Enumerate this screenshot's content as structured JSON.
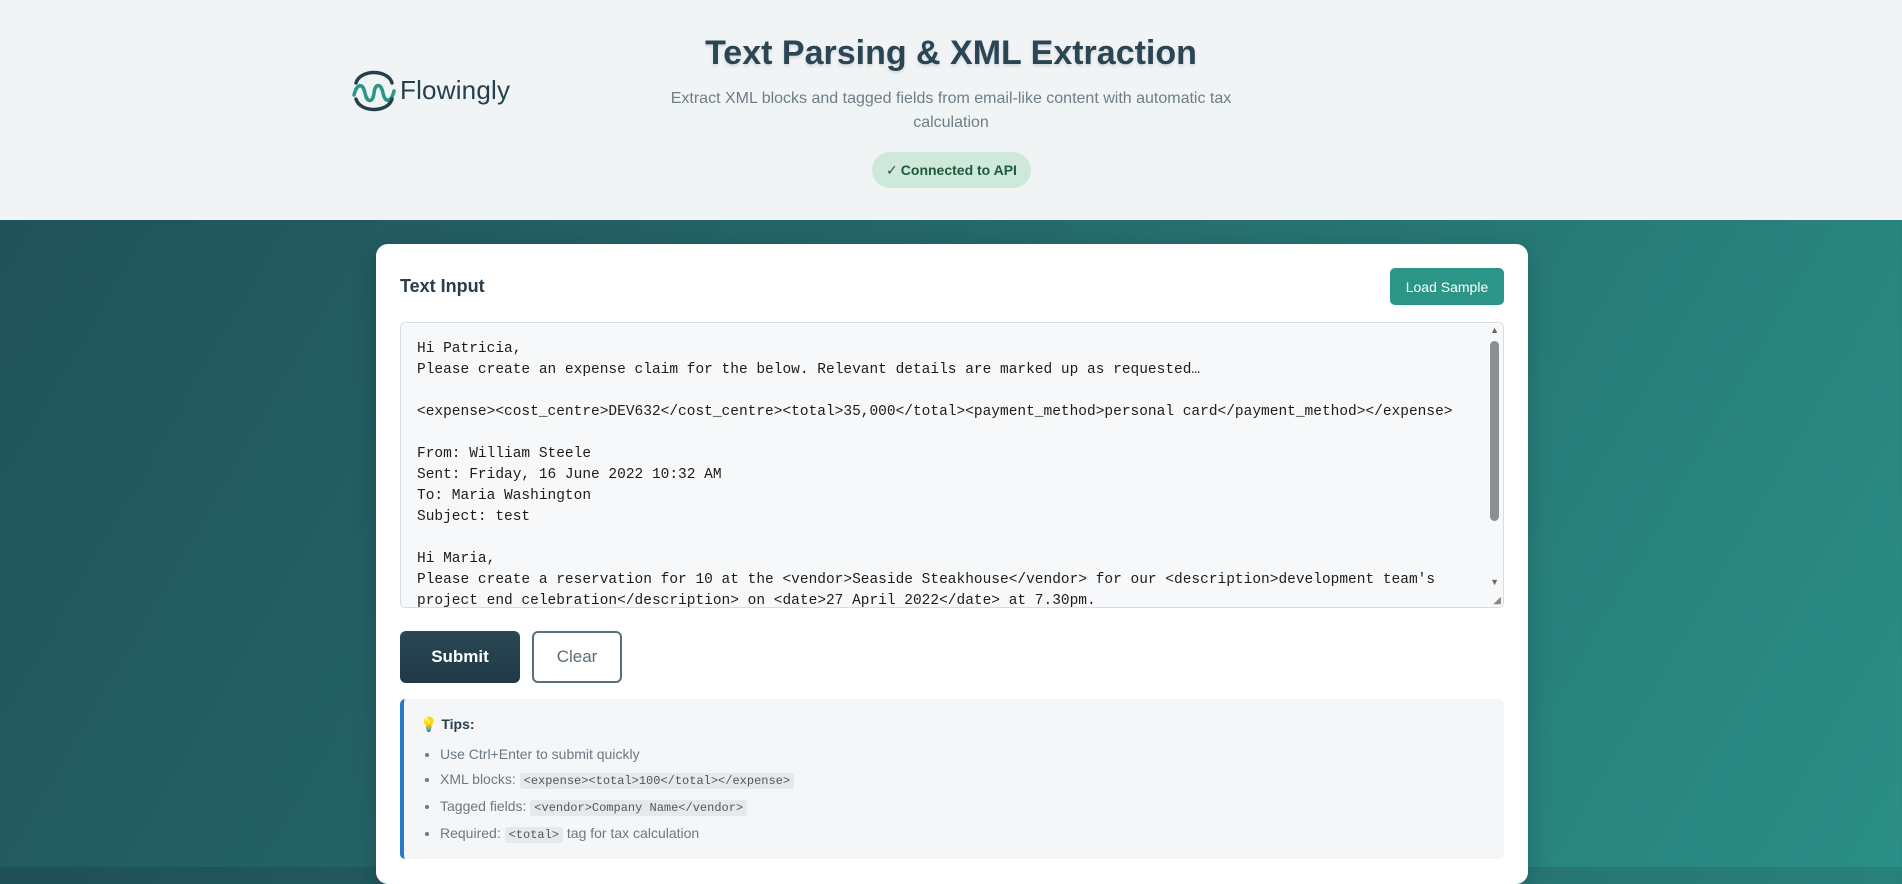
{
  "header": {
    "logo_text": "Flowingly",
    "title": "Text Parsing & XML Extraction",
    "subtitle": "Extract XML blocks and tagged fields from email-like content with automatic tax calculation",
    "status_check": "✓",
    "status_label": "Connected to API"
  },
  "input_card": {
    "title": "Text Input",
    "load_sample_label": "Load Sample",
    "text_value": "Hi Patricia,\nPlease create an expense claim for the below. Relevant details are marked up as requested…\n\n<expense><cost_centre>DEV632</cost_centre><total>35,000</total><payment_method>personal card</payment_method></expense>\n\nFrom: William Steele\nSent: Friday, 16 June 2022 10:32 AM\nTo: Maria Washington\nSubject: test\n\nHi Maria,\nPlease create a reservation for 10 at the <vendor>Seaside Steakhouse</vendor> for our <description>development team's project end celebration</description> on <date>27 April 2022</date> at 7.30pm.",
    "submit_label": "Submit",
    "clear_label": "Clear"
  },
  "tips": {
    "icon": "lightbulb-icon",
    "icon_glyph": "💡",
    "heading": "Tips:",
    "item1": "Use Ctrl+Enter to submit quickly",
    "item2_prefix": "XML blocks:",
    "item2_code": "<expense><total>100</total></expense>",
    "item3_prefix": "Tagged fields:",
    "item3_code": "<vendor>Company Name</vendor>",
    "item4_prefix": "Required:",
    "item4_code": "<total>",
    "item4_suffix": "tag for tax calculation"
  },
  "colors": {
    "accent": "#2b9688",
    "primary_dark": "#1f3a46",
    "status_bg": "#cfe8dc",
    "tips_border": "#2979c8"
  }
}
